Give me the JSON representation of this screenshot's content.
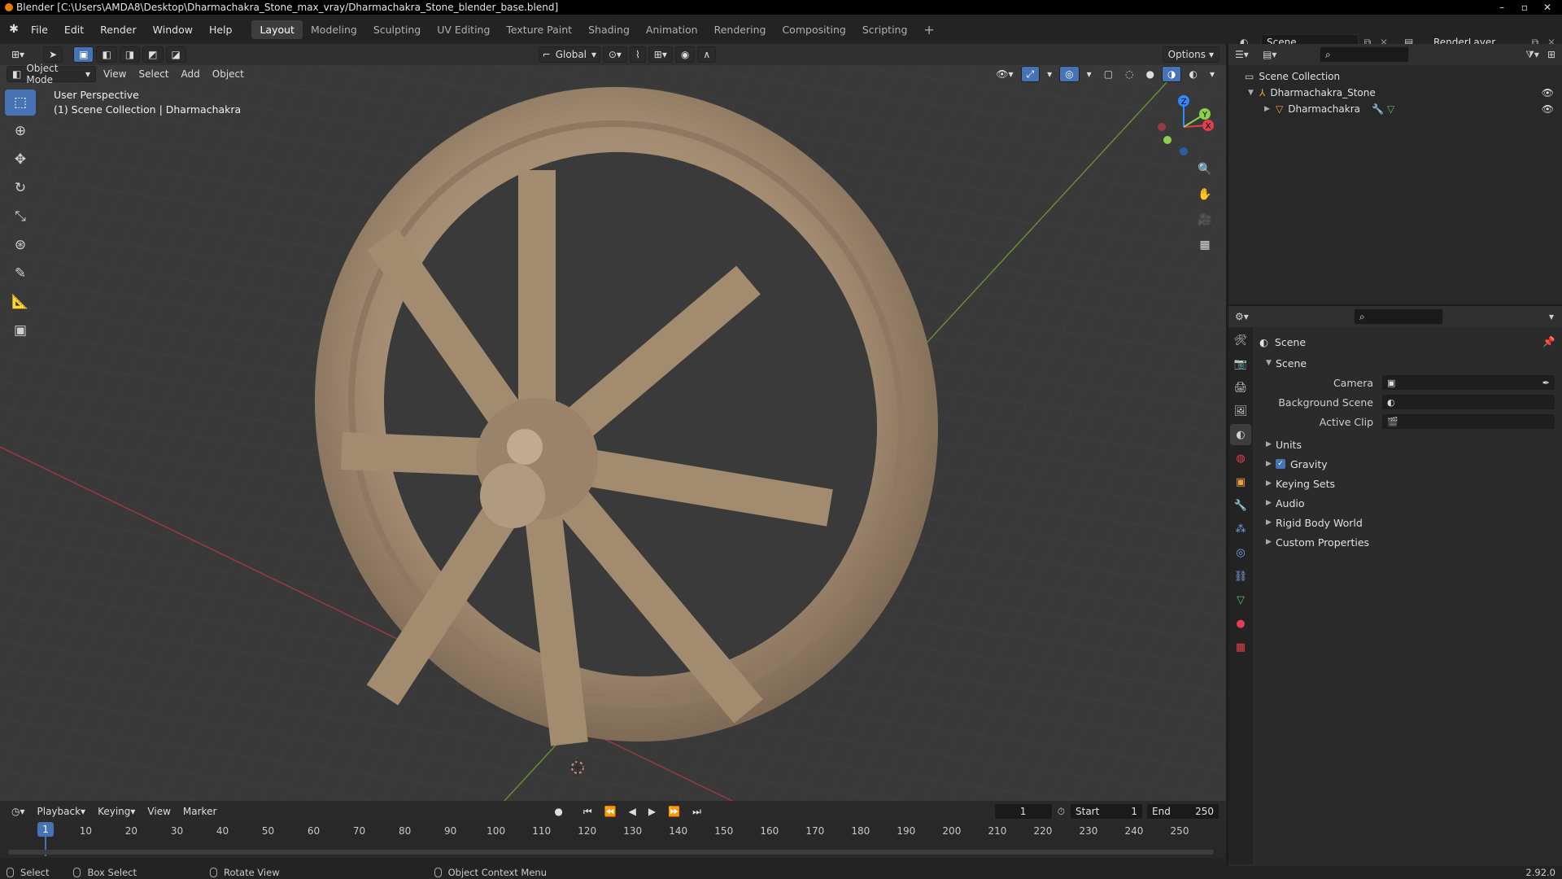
{
  "window": {
    "title": "Blender [C:\\Users\\AMDA8\\Desktop\\Dharmachakra_Stone_max_vray/Dharmachakra_Stone_blender_base.blend]"
  },
  "menu": {
    "items": [
      "File",
      "Edit",
      "Render",
      "Window",
      "Help"
    ]
  },
  "workspaces": {
    "tabs": [
      "Layout",
      "Modeling",
      "Sculpting",
      "UV Editing",
      "Texture Paint",
      "Shading",
      "Animation",
      "Rendering",
      "Compositing",
      "Scripting"
    ],
    "active": "Layout"
  },
  "scene_selector": {
    "value": "Scene"
  },
  "renderlayer_selector": {
    "value": "RenderLayer"
  },
  "viewport": {
    "mode": "Object Mode",
    "menus": [
      "View",
      "Select",
      "Add",
      "Object"
    ],
    "orientation": "Global",
    "options_label": "Options",
    "info_line1": "User Perspective",
    "info_line2": "(1) Scene Collection | Dharmachakra",
    "gizmo": {
      "x": "X",
      "y": "Y",
      "z": "Z"
    }
  },
  "timeline": {
    "menus": [
      "Playback",
      "Keying",
      "View",
      "Marker"
    ],
    "current_frame": "1",
    "start_label": "Start",
    "start": "1",
    "end_label": "End",
    "end": "250",
    "ticks": [
      "1",
      "10",
      "20",
      "30",
      "40",
      "50",
      "60",
      "70",
      "80",
      "90",
      "100",
      "110",
      "120",
      "130",
      "140",
      "150",
      "160",
      "170",
      "180",
      "190",
      "200",
      "210",
      "220",
      "230",
      "240",
      "250"
    ]
  },
  "outliner": {
    "root": "Scene Collection",
    "items": [
      {
        "label": "Dharmachakra_Stone"
      },
      {
        "label": "Dharmachakra"
      }
    ]
  },
  "properties": {
    "context": "Scene",
    "panel": "Scene",
    "fields": [
      {
        "label": "Camera",
        "value": ""
      },
      {
        "label": "Background Scene",
        "value": ""
      },
      {
        "label": "Active Clip",
        "value": ""
      }
    ],
    "subpanels": [
      "Units",
      "Gravity",
      "Keying Sets",
      "Audio",
      "Rigid Body World",
      "Custom Properties"
    ]
  },
  "statusbar": {
    "items": [
      "Select",
      "Box Select",
      "Rotate View",
      "Object Context Menu"
    ],
    "version": "2.92.0"
  },
  "colors": {
    "accent": "#4772b3",
    "x_axis": "#e33e4f",
    "y_axis": "#8bd04a",
    "z_axis": "#2f88ff"
  }
}
